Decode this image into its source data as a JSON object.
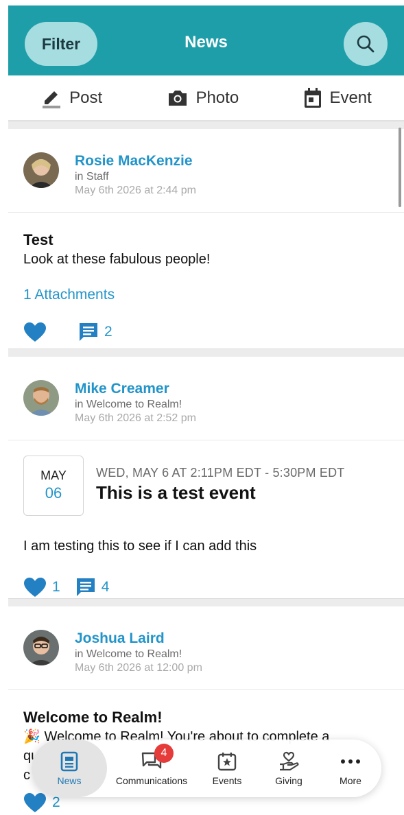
{
  "header": {
    "filter_label": "Filter",
    "title": "News",
    "search_icon": "search-icon"
  },
  "composer": {
    "post_label": "Post",
    "photo_label": "Photo",
    "event_label": "Event"
  },
  "posts": [
    {
      "author": "Rosie MacKenzie",
      "group": "in Staff",
      "date": "May 6th 2026 at 2:44 pm",
      "title": "Test",
      "body": "Look at these fabulous people!",
      "attachments": "1 Attachments",
      "likes": "",
      "comments": "2"
    },
    {
      "author": "Mike Creamer",
      "group": "in Welcome to Realm!",
      "date": "May 6th 2026 at 2:52 pm",
      "event": {
        "month": "MAY",
        "day": "06",
        "time": "WED, MAY 6 AT 2:11PM EDT - 5:30PM EDT",
        "title": "This is a test event"
      },
      "body": "I am testing this to see if I can add this",
      "likes": "1",
      "comments": "4"
    },
    {
      "author": "Joshua Laird",
      "group": "in Welcome to Realm!",
      "date": "May 6th 2026 at 12:00 pm",
      "title": "Welcome to Realm!",
      "body": "🎉 Welcome to Realm! You're about to complete a",
      "body_line2": "qu",
      "body_line3": "c",
      "likes": "2"
    }
  ],
  "tabbar": {
    "news": "News",
    "communications": "Communications",
    "communications_badge": "4",
    "events": "Events",
    "giving": "Giving",
    "more": "More"
  },
  "colors": {
    "brand": "#1e9ea9",
    "accent": "#2294c9",
    "badge": "#e63b3b"
  }
}
